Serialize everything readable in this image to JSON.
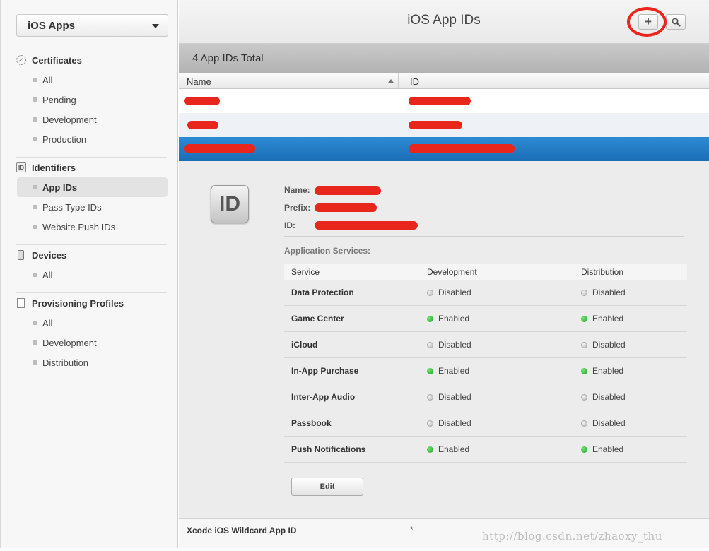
{
  "sidebar": {
    "platform": "iOS Apps",
    "groups": [
      {
        "title": "Certificates",
        "items": [
          "All",
          "Pending",
          "Development",
          "Production"
        ]
      },
      {
        "title": "Identifiers",
        "items": [
          "App IDs",
          "Pass Type IDs",
          "Website Push IDs"
        ]
      },
      {
        "title": "Devices",
        "items": [
          "All"
        ]
      },
      {
        "title": "Provisioning Profiles",
        "items": [
          "All",
          "Development",
          "Distribution"
        ]
      }
    ],
    "identifier_badge": "ID"
  },
  "main": {
    "title": "iOS App IDs",
    "add_button": "+",
    "count": "4 App IDs Total",
    "columns": {
      "name": "Name",
      "id": "ID"
    },
    "detail": {
      "icon_text": "ID",
      "name_label": "Name:",
      "prefix_label": "Prefix:",
      "id_label": "ID:",
      "services_title": "Application Services:",
      "service_columns": [
        "Service",
        "Development",
        "Distribution"
      ],
      "services": [
        {
          "name": "Data Protection",
          "development": "Disabled",
          "distribution": "Disabled"
        },
        {
          "name": "Game Center",
          "development": "Enabled",
          "distribution": "Enabled"
        },
        {
          "name": "iCloud",
          "development": "Disabled",
          "distribution": "Disabled"
        },
        {
          "name": "In-App Purchase",
          "development": "Enabled",
          "distribution": "Enabled"
        },
        {
          "name": "Inter-App Audio",
          "development": "Disabled",
          "distribution": "Disabled"
        },
        {
          "name": "Passbook",
          "development": "Disabled",
          "distribution": "Disabled"
        },
        {
          "name": "Push Notifications",
          "development": "Enabled",
          "distribution": "Enabled"
        }
      ],
      "edit_label": "Edit"
    },
    "wildcard": {
      "name": "Xcode iOS Wildcard App ID",
      "id": "*"
    }
  },
  "watermark": "http://blog.csdn.net/zhaoxy_thu",
  "colors": {
    "redaction": "#e8261b",
    "selection": "#1f76c0",
    "enabled": "#22a822"
  }
}
